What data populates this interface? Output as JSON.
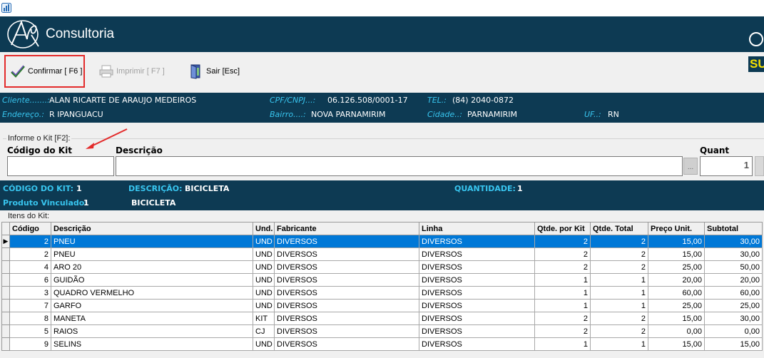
{
  "brand": {
    "name": "Consultoria"
  },
  "toolbar": {
    "confirm_label": "Confirmar [ F6 ]",
    "print_label": "Imprimir  [ F7 ]",
    "exit_label": "Sair   [Esc]",
    "badge_text": "SU"
  },
  "client": {
    "cliente_label": "Cliente.......:",
    "cliente_value": "ALAN RICARTE DE ARAUJO MEDEIROS",
    "cpf_label": "CPF/CNPJ...:",
    "cpf_value": "06.126.508/0001-17",
    "tel_label": "TEL.:",
    "tel_value": "(84) 2040-0872",
    "endereco_label": "Endereço.:",
    "endereco_value": "R IPANGUACU",
    "bairro_label": "Bairro....:",
    "bairro_value": "NOVA PARNAMIRIM",
    "cidade_label": "Cidade..:",
    "cidade_value": "PARNAMIRIM",
    "uf_label": "UF..:",
    "uf_value": "RN"
  },
  "kit_form": {
    "group_caption": "Informe o Kit [F2]:",
    "codigo_label": "Código do Kit",
    "codigo_value": "",
    "descricao_label": "Descrição",
    "descricao_value": "",
    "browse_label": "...",
    "quant_label": "Quant",
    "quant_value": "1"
  },
  "kit_info": {
    "codigo_label": "CÓDIGO DO KIT:",
    "codigo_value": "1",
    "descricao_label": "DESCRIÇÃO:",
    "descricao_value": "BICICLETA",
    "quantidade_label": "QUANTIDADE:",
    "quantidade_value": "1",
    "produto_label": "Produto Vinculado:",
    "produto_value": "1",
    "produto_desc": "BICICLETA"
  },
  "items": {
    "caption": "Itens do Kit:",
    "columns": [
      "Código",
      "Descrição",
      "Und.",
      "Fabricante",
      "Linha",
      "Qtde. por Kit",
      "Qtde. Total",
      "Preço Unit.",
      "Subtotal"
    ],
    "rows": [
      [
        "2",
        "PNEU",
        "UND",
        "DIVERSOS",
        "DIVERSOS",
        "2",
        "2",
        "15,00",
        "30,00"
      ],
      [
        "2",
        "PNEU",
        "UND",
        "DIVERSOS",
        "DIVERSOS",
        "2",
        "2",
        "15,00",
        "30,00"
      ],
      [
        "4",
        "ARO 20",
        "UND",
        "DIVERSOS",
        "DIVERSOS",
        "2",
        "2",
        "25,00",
        "50,00"
      ],
      [
        "6",
        "GUIDÃO",
        "UND",
        "DIVERSOS",
        "DIVERSOS",
        "1",
        "1",
        "20,00",
        "20,00"
      ],
      [
        "3",
        "QUADRO VERMELHO",
        "UND",
        "DIVERSOS",
        "DIVERSOS",
        "1",
        "1",
        "60,00",
        "60,00"
      ],
      [
        "7",
        "GARFO",
        "UND",
        "DIVERSOS",
        "DIVERSOS",
        "1",
        "1",
        "25,00",
        "25,00"
      ],
      [
        "8",
        "MANETA",
        "KIT",
        "DIVERSOS",
        "DIVERSOS",
        "2",
        "2",
        "15,00",
        "30,00"
      ],
      [
        "5",
        "RAIOS",
        "CJ",
        "DIVERSOS",
        "DIVERSOS",
        "2",
        "2",
        "0,00",
        "0,00"
      ],
      [
        "9",
        "SELINS",
        "UND",
        "DIVERSOS",
        "DIVERSOS",
        "1",
        "1",
        "15,00",
        "15,00"
      ]
    ],
    "selected_row": 0
  },
  "colors": {
    "header_bg": "#0d3a53",
    "label_cyan": "#38c5ef",
    "selection": "#0078d7",
    "highlight_red": "#e32b2b",
    "badge_yellow": "#f7e200"
  }
}
